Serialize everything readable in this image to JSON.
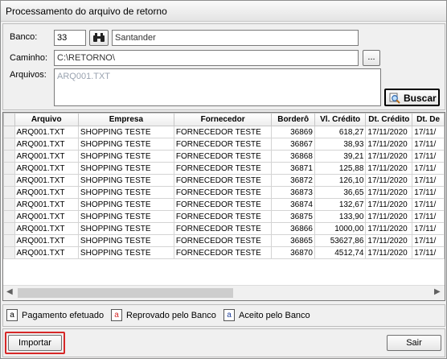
{
  "window": {
    "title": "Processamento do arquivo de retorno"
  },
  "form": {
    "banco_label": "Banco:",
    "banco_code": "33",
    "banco_name": "Santander",
    "caminho_label": "Caminho:",
    "caminho_value": "C:\\RETORNO\\",
    "browse_label": "...",
    "arquivos_label": "Arquivos:",
    "arquivos_value": "ARQ001.TXT",
    "buscar_label": "Buscar"
  },
  "grid": {
    "columns": [
      "Arquivo",
      "Empresa",
      "Fornecedor",
      "Borderô",
      "Vl. Crédito",
      "Dt. Crédito",
      "Dt. De"
    ],
    "rows": [
      [
        "ARQ001.TXT",
        "SHOPPING TESTE",
        "FORNECEDOR TESTE",
        "36869",
        "618,27",
        "17/11/2020",
        "17/11/"
      ],
      [
        "ARQ001.TXT",
        "SHOPPING TESTE",
        "FORNECEDOR TESTE",
        "36867",
        "38,93",
        "17/11/2020",
        "17/11/"
      ],
      [
        "ARQ001.TXT",
        "SHOPPING TESTE",
        "FORNECEDOR TESTE",
        "36868",
        "39,21",
        "17/11/2020",
        "17/11/"
      ],
      [
        "ARQ001.TXT",
        "SHOPPING TESTE",
        "FORNECEDOR TESTE",
        "36871",
        "125,88",
        "17/11/2020",
        "17/11/"
      ],
      [
        "ARQ001.TXT",
        "SHOPPING TESTE",
        "FORNECEDOR TESTE",
        "36872",
        "126,10",
        "17/11/2020",
        "17/11/"
      ],
      [
        "ARQ001.TXT",
        "SHOPPING TESTE",
        "FORNECEDOR TESTE",
        "36873",
        "36,65",
        "17/11/2020",
        "17/11/"
      ],
      [
        "ARQ001.TXT",
        "SHOPPING TESTE",
        "FORNECEDOR TESTE",
        "36874",
        "132,67",
        "17/11/2020",
        "17/11/"
      ],
      [
        "ARQ001.TXT",
        "SHOPPING TESTE",
        "FORNECEDOR TESTE",
        "36875",
        "133,90",
        "17/11/2020",
        "17/11/"
      ],
      [
        "ARQ001.TXT",
        "SHOPPING TESTE",
        "FORNECEDOR TESTE",
        "36866",
        "1000,00",
        "17/11/2020",
        "17/11/"
      ],
      [
        "ARQ001.TXT",
        "SHOPPING TESTE",
        "FORNECEDOR TESTE",
        "36865",
        "53627,86",
        "17/11/2020",
        "17/11/"
      ],
      [
        "ARQ001.TXT",
        "SHOPPING TESTE",
        "FORNECEDOR TESTE",
        "36870",
        "4512,74",
        "17/11/2020",
        "17/11/"
      ]
    ]
  },
  "legend": [
    {
      "glyph": "a",
      "label": "Pagamento efetuado",
      "color": "#000000"
    },
    {
      "glyph": "a",
      "label": "Reprovado pelo Banco",
      "color": "#d62828"
    },
    {
      "glyph": "a",
      "label": "Aceito pelo Banco",
      "color": "#1f3f9a"
    }
  ],
  "footer": {
    "importar_label": "Importar",
    "sair_label": "Sair",
    "highlight_color": "#d62828"
  },
  "icons": {
    "search": "binoculars-icon",
    "buscar": "magnifier-icon"
  }
}
